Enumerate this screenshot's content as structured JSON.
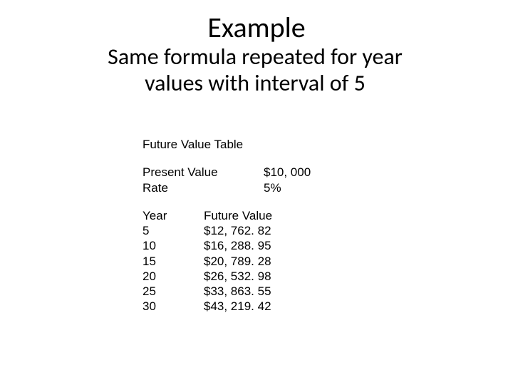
{
  "title": "Example",
  "subtitle_line1": "Same formula repeated for year",
  "subtitle_line2": "values with interval of 5",
  "content": {
    "heading": "Future Value Table",
    "params": {
      "present_value_label": "Present Value",
      "present_value_value": "$10, 000",
      "rate_label": "Rate",
      "rate_value": "5%"
    },
    "table": {
      "header_year": "Year",
      "header_fv": "Future Value",
      "rows": [
        {
          "year": "5",
          "fv": "$12, 762. 82"
        },
        {
          "year": "10",
          "fv": "$16, 288. 95"
        },
        {
          "year": "15",
          "fv": "$20, 789. 28"
        },
        {
          "year": "20",
          "fv": "$26, 532. 98"
        },
        {
          "year": "25",
          "fv": "$33, 863. 55"
        },
        {
          "year": "30",
          "fv": "$43, 219. 42"
        }
      ]
    }
  }
}
